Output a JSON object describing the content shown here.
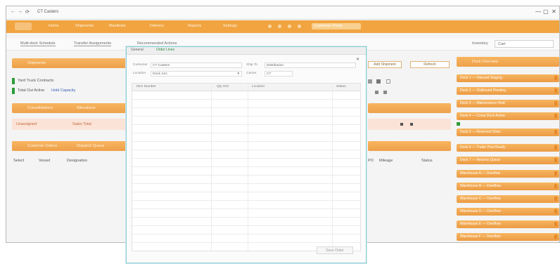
{
  "window": {
    "title": "CT Casters",
    "controls": [
      "←",
      "→",
      "⟳"
    ],
    "window_buttons": [
      "—",
      "▢",
      "✕"
    ]
  },
  "menubar": {
    "items": [
      "Home",
      "Shipments",
      "Manifests",
      "Delivery",
      "Reports",
      "Settings"
    ],
    "right_item": "Customer Portal"
  },
  "toolbar": {
    "tabs": [
      "Multi-dock Schedule",
      "Transfer Assignments",
      "Recommended Actions"
    ],
    "filter_label": "Inventory",
    "filter_value": "Cart"
  },
  "left_panel": {
    "header_1": "Shipments",
    "rows": [
      {
        "text": "Yard Truck Contracts",
        "link": ""
      },
      {
        "text": "Total Out Active",
        "link": "Hold Capacity"
      }
    ],
    "header_2": "Consolidations",
    "header_2b": "Allocations",
    "pink_row": {
      "a": "Unassigned",
      "b": "Sales Total"
    },
    "header_3": "Customer Orders",
    "header_3b": "Dispatch Queue",
    "columns": [
      "Select",
      "Vessel",
      "Designation"
    ]
  },
  "mid_panel": {
    "btn_1": "Add Shipment",
    "btn_2": "Refresh",
    "columns": [
      "PO",
      "Mileage",
      "Status"
    ]
  },
  "modal": {
    "tabs": [
      "General",
      "Order Lines"
    ],
    "close": "✕",
    "fields": [
      {
        "label": "Customer",
        "value": "CT Casters"
      },
      {
        "label": "Ship To",
        "value": "Distribution"
      },
      {
        "label": "Location",
        "value": "Dock 14A"
      },
      {
        "label": "Carrier",
        "value": "CT"
      }
    ],
    "grid_columns": [
      "Item Number",
      "Qty Ord",
      "Location",
      "Status"
    ],
    "ok_label": "Save Order"
  },
  "right_panel": {
    "header": "Dock Overview",
    "items": [
      "Dock 1 — Inbound Staging",
      "Dock 2 — Outbound Pending",
      "Dock 3 — Maintenance Hold",
      "Dock 4 — Cross Dock Active",
      "Dock 5 — Reserved Slots",
      "Dock 6 — Trailer Pool Ready",
      "Dock 7 — Returns Queue",
      "Warehouse A — Overflow",
      "Warehouse B — Overflow",
      "Warehouse C — Overflow",
      "Warehouse D — Overflow",
      "Warehouse E — Overflow",
      "Warehouse F — Overflow"
    ]
  },
  "colors": {
    "accent": "#f1a440",
    "link": "#3a62b8",
    "status_green": "#2e9d3a",
    "modal_border": "#8fcdd6"
  }
}
